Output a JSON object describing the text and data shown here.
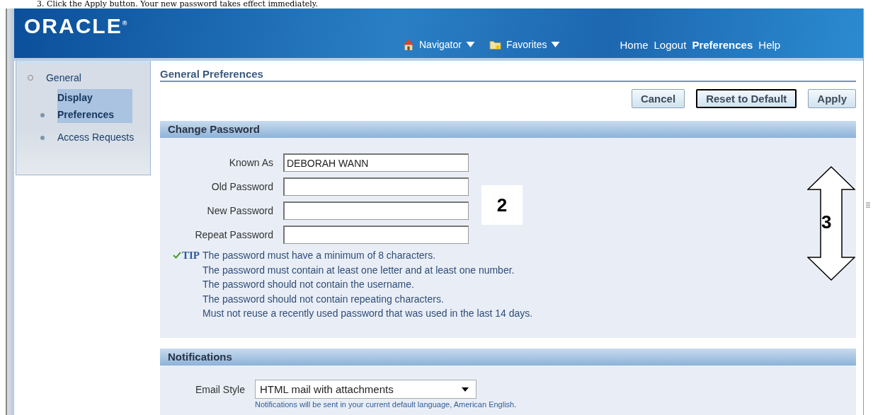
{
  "doc_instruction": "3.  Click the Apply button.  Your new password takes effect immediately.",
  "header": {
    "logo": "ORACLE$^{®}$",
    "menus": [
      {
        "label": "Navigator",
        "kind": "navigator"
      },
      {
        "label": "Favorites",
        "kind": "favorites"
      }
    ],
    "links": [
      {
        "label": "Home",
        "selected": false
      },
      {
        "label": "Logout",
        "selected": false
      },
      {
        "label": "Preferences",
        "selected": true
      },
      {
        "label": "Help",
        "selected": false
      }
    ]
  },
  "sidebar": {
    "items": [
      {
        "label": "General",
        "selected": false,
        "children": [
          {
            "label": "Display Preferences",
            "selected": true
          },
          {
            "label": "Access Requests",
            "selected": false
          }
        ]
      }
    ]
  },
  "page_title": "General Preferences",
  "buttons": [
    {
      "label": "Cancel",
      "default": false
    },
    {
      "label": "Reset to Default",
      "default": true
    },
    {
      "label": "Apply",
      "default": false
    }
  ],
  "change_password": {
    "title": "Change Password",
    "fields": [
      {
        "label": "Known As",
        "value": "DEBORAH WANN"
      },
      {
        "label": "Old Password"
      },
      {
        "label": "New Password"
      },
      {
        "label": "Repeat Password"
      }
    ],
    "tip_label": "TIP",
    "tips": [
      "The password must have a minimum of 8 characters.",
      "The password must contain at least one letter and at least one number.",
      "The password should not contain the username.",
      "The password should not contain repeating characters.",
      "Must not reuse a recently used password that was used in the last 14 days."
    ]
  },
  "notifications": {
    "title": "Notifications",
    "fields": [
      {
        "label": "Email Style",
        "value": "HTML mail with attachments",
        "hint": "Notifications will be sent in your current default language, American English."
      }
    ]
  },
  "annotations": [
    {
      "label": "2",
      "kind": "box"
    },
    {
      "label": "3",
      "kind": "double-arrow"
    }
  ]
}
